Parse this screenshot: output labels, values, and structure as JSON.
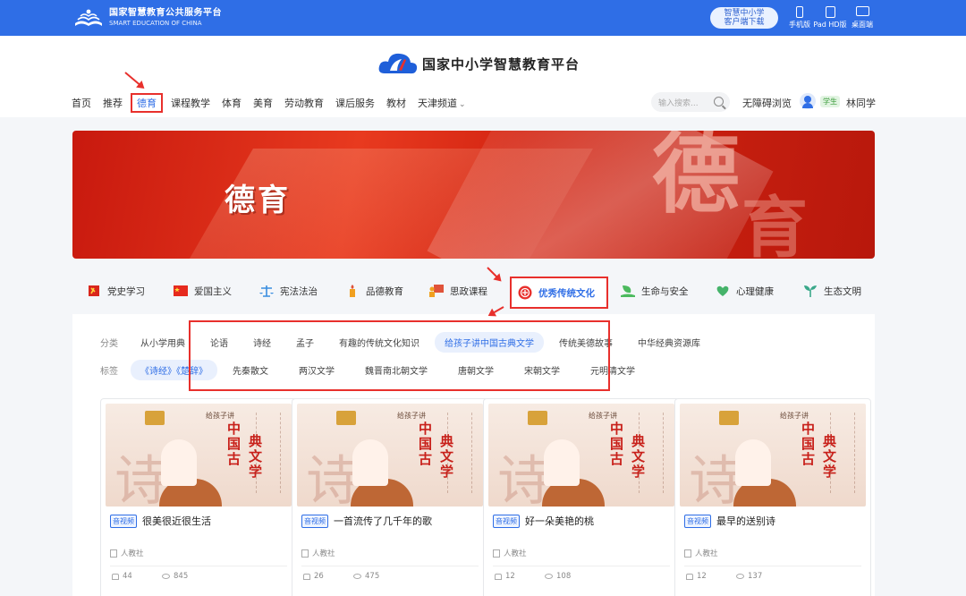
{
  "topbar": {
    "logo_cn": "国家智慧教育公共服务平台",
    "logo_en": "SMART EDUCATION OF CHINA",
    "app_button_line1": "智慧中小学",
    "app_button_line2": "客户端下载",
    "devices": [
      "手机版",
      "Pad HD版",
      "桌面端"
    ]
  },
  "header": {
    "brand_name": "国家中小学智慧教育平台"
  },
  "nav": {
    "items": [
      "首页",
      "推荐",
      "德育",
      "课程教学",
      "体育",
      "美育",
      "劳动教育",
      "课后服务",
      "教材",
      "天津频道"
    ],
    "active": "德育"
  },
  "search": {
    "placeholder": "输入搜索..."
  },
  "accessibility": "无障碍浏览",
  "user": {
    "role": "学生",
    "name": "林同学"
  },
  "banner": {
    "title": "德育",
    "big_glyph_1": "德",
    "big_glyph_2": "育"
  },
  "categories": [
    {
      "label": "党史学习",
      "icon": "party-flag-icon",
      "color": "#d9261c"
    },
    {
      "label": "爱国主义",
      "icon": "national-flag-icon",
      "color": "#e62a1e"
    },
    {
      "label": "宪法法治",
      "icon": "scales-icon",
      "color": "#3a8ee0"
    },
    {
      "label": "品德教育",
      "icon": "candle-icon",
      "color": "#f0a020"
    },
    {
      "label": "思政课程",
      "icon": "lecture-icon",
      "color": "#e0533a"
    },
    {
      "label": "优秀传统文化",
      "icon": "culture-seal-icon",
      "color": "#e8302c"
    },
    {
      "label": "生命与安全",
      "icon": "leaf-hand-icon",
      "color": "#4cba5e"
    },
    {
      "label": "心理健康",
      "icon": "heart-leaf-icon",
      "color": "#45b36a"
    },
    {
      "label": "生态文明",
      "icon": "sprout-icon",
      "color": "#3aa88a"
    }
  ],
  "active_category": "优秀传统文化",
  "filters": {
    "row1_label": "分类",
    "row1": [
      "从小学用典",
      "论语",
      "诗经",
      "孟子",
      "有趣的传统文化知识",
      "给孩子讲中国古典文学",
      "传统美德故事",
      "中华经典资源库"
    ],
    "row1_active": "给孩子讲中国古典文学",
    "row2_label": "标签",
    "row2": [
      "《诗经》《楚辞》",
      "先秦散文",
      "两汉文学",
      "魏晋南北朝文学",
      "唐朝文学",
      "宋朝文学",
      "元明清文学"
    ],
    "row2_active": "《诗经》《楚辞》"
  },
  "cards": [
    {
      "tag": "音视频",
      "title": "很美很近很生活",
      "publisher": "人教社",
      "likes": "44",
      "views": "845"
    },
    {
      "tag": "音视频",
      "title": "一首流传了几千年的歌",
      "publisher": "人教社",
      "likes": "26",
      "views": "475"
    },
    {
      "tag": "音视频",
      "title": "好一朵美艳的桃",
      "publisher": "人教社",
      "likes": "12",
      "views": "108"
    },
    {
      "tag": "音视频",
      "title": "最早的送别诗",
      "publisher": "人教社",
      "likes": "12",
      "views": "137"
    }
  ],
  "card_thumb": {
    "subtitle": "给孩子讲",
    "title_col1": "中国古",
    "title_col2": "典文学",
    "brush_glyph": "诗"
  },
  "colors": {
    "primary": "#2f6ee6",
    "annotation_red": "#e8302c",
    "banner_red": "#d42512"
  }
}
